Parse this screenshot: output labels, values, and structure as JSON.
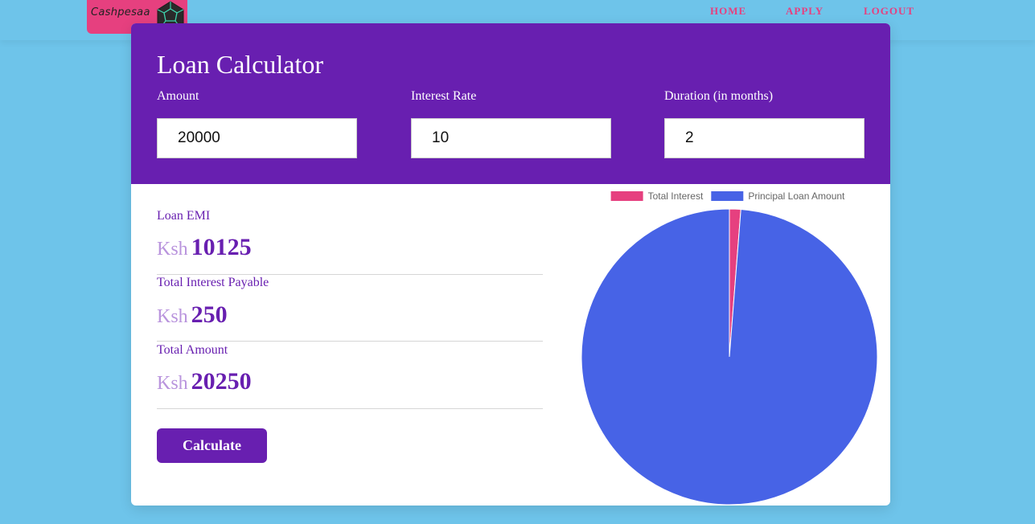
{
  "brand": {
    "name": "Cashpesaa",
    "logo_color": "#e6407f",
    "logo_icon": "dodecahedron-icon"
  },
  "nav": {
    "items": [
      {
        "label": "HOME"
      },
      {
        "label": "APPLY"
      },
      {
        "label": "LOGOUT"
      }
    ]
  },
  "calculator": {
    "title": "Loan Calculator",
    "fields": [
      {
        "label": "Amount",
        "value": "20000"
      },
      {
        "label": "Interest Rate",
        "value": "10"
      },
      {
        "label": "Duration (in months)",
        "value": "2"
      }
    ]
  },
  "results": [
    {
      "label": "Loan EMI",
      "currency": "Ksh",
      "value": "10125"
    },
    {
      "label": "Total Interest Payable",
      "currency": "Ksh",
      "value": "250"
    },
    {
      "label": "Total Amount",
      "currency": "Ksh",
      "value": "20250"
    }
  ],
  "actions": {
    "calculate_label": "Calculate"
  },
  "colors": {
    "page_bg": "#6ec4ea",
    "header_bg": "#681fb0",
    "accent_pink": "#e6407f",
    "interest_slice": "#e6407f",
    "principal_slice": "#4763e6"
  },
  "chart_data": {
    "type": "pie",
    "title": "",
    "legend_position": "top",
    "series": [
      {
        "name": "Total Interest",
        "value": 250,
        "color": "#e6407f"
      },
      {
        "name": "Principal Loan Amount",
        "value": 20000,
        "color": "#4763e6"
      }
    ]
  }
}
